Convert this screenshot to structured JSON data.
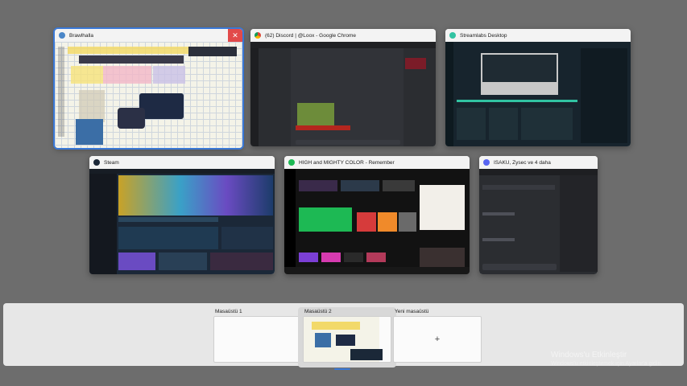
{
  "windows": [
    {
      "title": "Brawlhalla",
      "icon": "brawlhalla-icon",
      "accent": "#4a86c8"
    },
    {
      "title": "(62) Discord | @Loox - Google Chrome",
      "icon": "chrome-icon",
      "accent": "#e8b339"
    },
    {
      "title": "Streamlabs Desktop",
      "icon": "streamlabs-icon",
      "accent": "#31c3a2"
    },
    {
      "title": "Steam",
      "icon": "steam-icon",
      "accent": "#1b2838"
    },
    {
      "title": "HIGH and MIGHTY COLOR - Remember",
      "icon": "spotify-icon",
      "accent": "#1db954"
    },
    {
      "title": "ISAKU, Zysec ve 4 daha",
      "icon": "discord-icon",
      "accent": "#5865f2"
    }
  ],
  "close_glyph": "✕",
  "desktops": [
    {
      "label": "Masaüstü 1"
    },
    {
      "label": "Masaüstü 2"
    },
    {
      "label": "Yeni masaüstü"
    }
  ],
  "new_desktop_glyph": "+",
  "watermark": {
    "title": "Windows'u Etkinleştir",
    "subtitle": "Windows'u etkinleştirmek için Ayarlar'a gidin."
  }
}
